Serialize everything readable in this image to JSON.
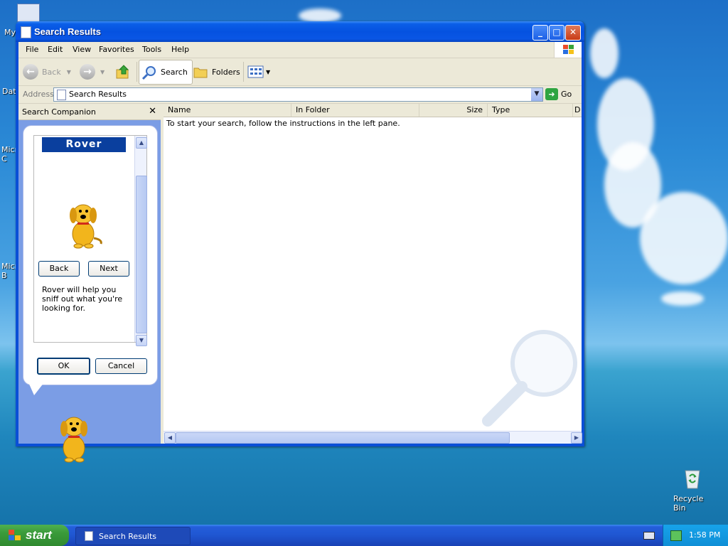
{
  "desktop": {
    "icons": [
      {
        "label": "My"
      },
      {
        "label": "Dat"
      },
      {
        "label": "Micro C"
      },
      {
        "label": "Micro B"
      }
    ],
    "recycle_bin": "Recycle Bin"
  },
  "window": {
    "title": "Search Results",
    "menu": [
      "File",
      "Edit",
      "View",
      "Favorites",
      "Tools",
      "Help"
    ],
    "toolbar": {
      "back": "Back",
      "search": "Search",
      "folders": "Folders"
    },
    "address": {
      "label": "Address",
      "value": "Search Results",
      "go": "Go"
    },
    "search_companion": {
      "title": "Search Companion",
      "character_name": "Rover",
      "back_button": "Back",
      "next_button": "Next",
      "description": "Rover will help you sniff out what you're looking for.",
      "ok_button": "OK",
      "cancel_button": "Cancel"
    },
    "results": {
      "columns": [
        "Name",
        "In Folder",
        "Size",
        "Type",
        "D"
      ],
      "empty_message": "To start your search, follow the instructions in the left pane."
    }
  },
  "taskbar": {
    "start": "start",
    "task_item": "Search Results",
    "clock": "1:58 PM"
  }
}
